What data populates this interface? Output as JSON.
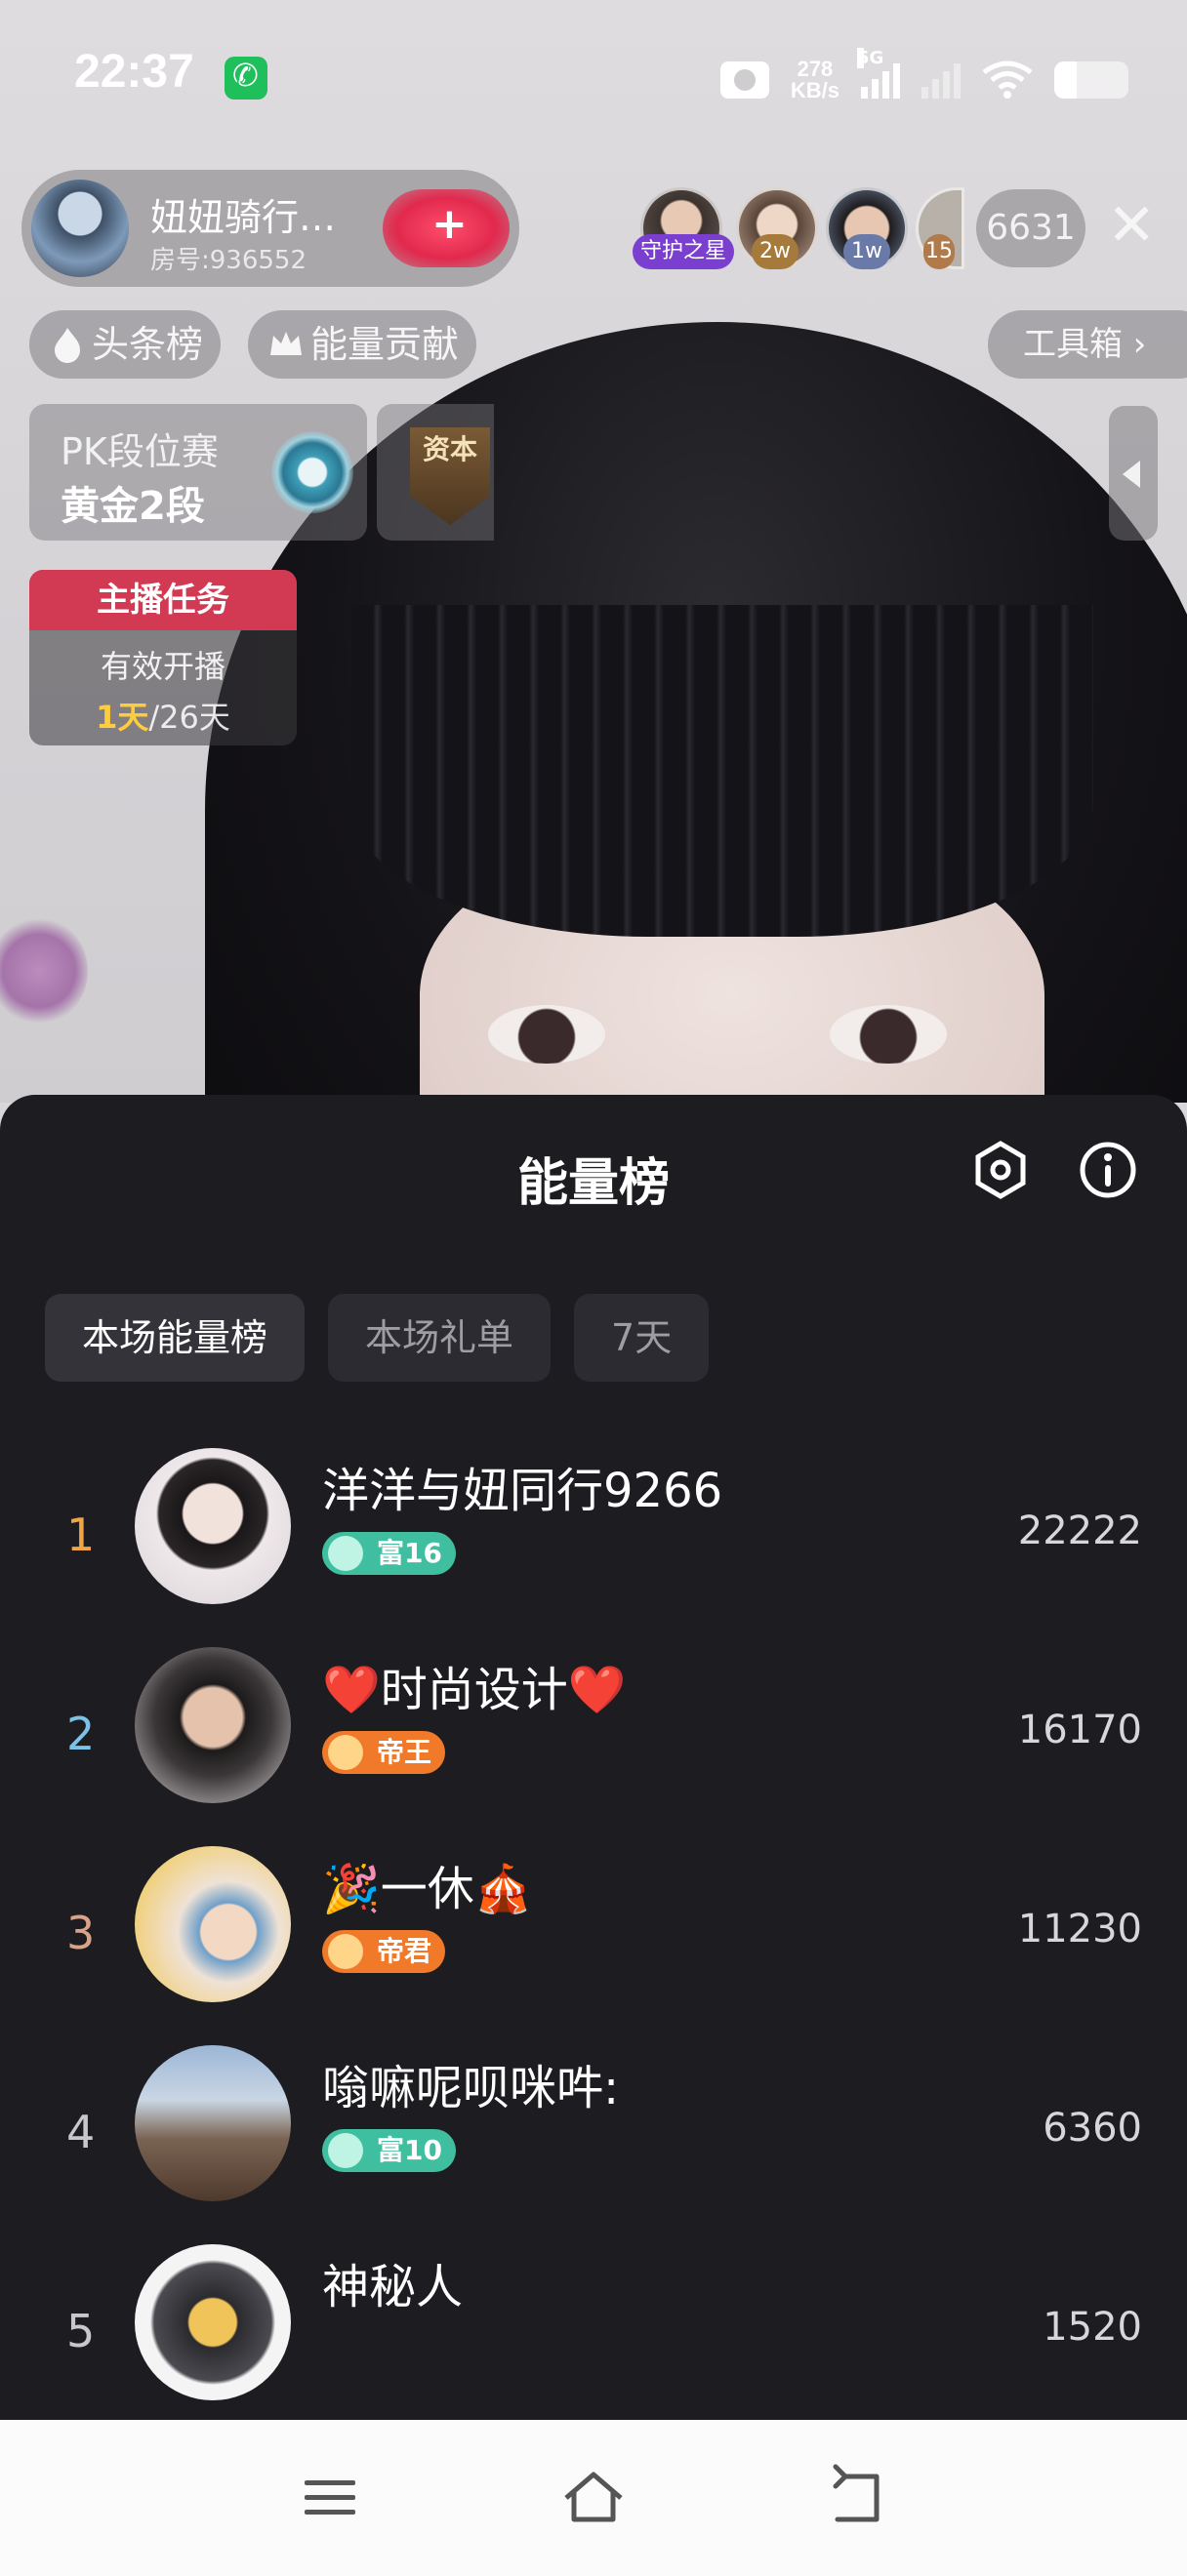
{
  "status_bar": {
    "time": "22:37",
    "net_speed_value": "278",
    "net_speed_unit": "KB/s",
    "network": "5G",
    "battery_level": 0.3
  },
  "live": {
    "host_name": "妞妞骑行…",
    "room_id": "房号:936552",
    "viewer_badges": [
      "守护之星",
      "2w",
      "1w",
      "15"
    ],
    "viewer_count": "6631",
    "chips": {
      "headline": "头条榜",
      "energy": "能量贡献",
      "toolbox": "工具箱 ›"
    },
    "pk": {
      "title": "PK段位赛",
      "rank": "黄金2段"
    },
    "capital_badge": "资本",
    "task": {
      "title": "主播任务",
      "label": "有效开播",
      "done": "1天",
      "total": "/26天"
    }
  },
  "sheet": {
    "title": "能量榜",
    "tabs": [
      "本场能量榜",
      "本场礼单",
      "7天"
    ],
    "active_tab": 0,
    "rows": [
      {
        "rank": "1",
        "name": "洋洋与妞同行9266",
        "badge": "富16",
        "badge_type": "wealth",
        "score": "22222",
        "rank_color": "#f0a445"
      },
      {
        "rank": "2",
        "name": "❤️时尚设计❤️",
        "badge": "帝王",
        "badge_type": "noble",
        "score": "16170",
        "rank_color": "#7cc2e6"
      },
      {
        "rank": "3",
        "name": "🎉一休🎪",
        "badge": "帝君",
        "badge_type": "noble",
        "score": "11230",
        "rank_color": "#d9a38a"
      },
      {
        "rank": "4",
        "name": "嗡嘛呢呗咪吽:",
        "badge": "富10",
        "badge_type": "wealth",
        "score": "6360",
        "rank_color": "#c8c7cc"
      },
      {
        "rank": "5",
        "name": "神秘人",
        "badge": "",
        "badge_type": "none",
        "score": "1520",
        "rank_color": "#c8c7cc"
      }
    ]
  },
  "colors": {
    "sheet_bg": "#1d1c21",
    "task_head": "#d23a54",
    "wealth_badge": "#3fbfa0",
    "noble_badge": "#f07a2a"
  }
}
